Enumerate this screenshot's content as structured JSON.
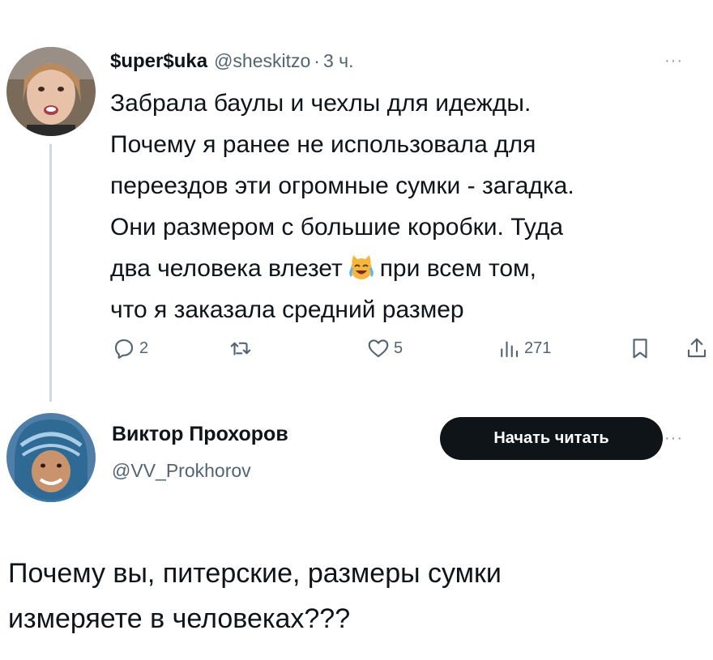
{
  "tweet": {
    "author_name": "$uper$uka",
    "handle": "@sheskitzo",
    "separator": "·",
    "time": "3 ч.",
    "more": "···",
    "text_lines": [
      "Забрала баулы и чехлы для идежды.",
      "Почему я ранее не использовала для",
      "переездов эти огромные сумки - загадка.",
      "Они размером с большие коробки. Туда"
    ],
    "text_line5_before": "два человека влезет",
    "text_line5_emoji": "laughing-crying-cat-emoji",
    "text_line5_after": "при всем том,",
    "text_line6": "что я заказала средний размер",
    "actions": {
      "replies": "2",
      "retweets": "",
      "likes": "5",
      "views": "271"
    }
  },
  "reply": {
    "author_name": "Виктор Прохоров",
    "handle": "@VV_Prokhorov",
    "follow_label": "Начать читать",
    "more": "···",
    "text_lines": [
      "Почему вы, питерские, размеры сумки",
      "измеряете в человеках???"
    ]
  },
  "icons": {
    "reply": "reply-icon",
    "retweet": "retweet-icon",
    "like": "heart-icon",
    "views": "views-icon",
    "bookmark": "bookmark-icon",
    "share": "share-icon"
  },
  "colors": {
    "text": "#0f1419",
    "secondary": "#536471",
    "thread_line": "#cfd9de",
    "button_bg": "#0f1419",
    "button_text": "#ffffff"
  }
}
